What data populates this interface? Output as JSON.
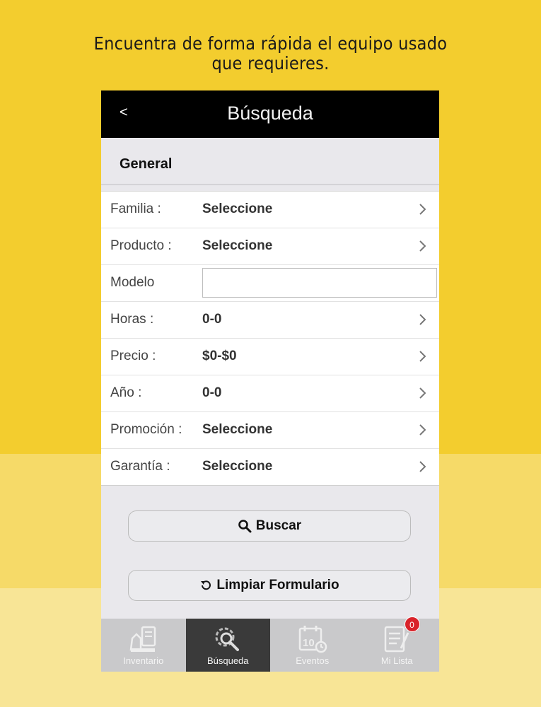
{
  "headline": {
    "line1": "Encuentra de forma rápida el equipo usado",
    "line2": "que requieres."
  },
  "titlebar": {
    "back_label": "<",
    "title": "Búsqueda"
  },
  "section": {
    "title": "General"
  },
  "form": {
    "rows": [
      {
        "label": "Familia :",
        "value": "Seleccione"
      },
      {
        "label": "Producto :",
        "value": "Seleccione"
      },
      {
        "label": "Modelo",
        "value": ""
      },
      {
        "label": "Horas :",
        "value": "0-0"
      },
      {
        "label": "Precio :",
        "value": "$0-$0"
      },
      {
        "label": "Año :",
        "value": "0-0"
      },
      {
        "label": "Promoción :",
        "value": "Seleccione"
      },
      {
        "label": "Garantía :",
        "value": "Seleccione"
      }
    ]
  },
  "buttons": {
    "search_label": "Buscar",
    "clear_label": "Limpiar Formulario"
  },
  "tabs": [
    {
      "label": "Inventario",
      "icon": "inventory-icon",
      "active": false
    },
    {
      "label": "Búsqueda",
      "icon": "search-gear-icon",
      "active": true
    },
    {
      "label": "Eventos",
      "icon": "calendar-icon",
      "active": false
    },
    {
      "label": "Mi Lista",
      "icon": "list-icon",
      "active": false,
      "badge": "0"
    }
  ],
  "colors": {
    "background": "#f3cd2e",
    "titlebar": "#000000",
    "badge": "#d9232a",
    "active_tab": "#3a3a3a"
  }
}
